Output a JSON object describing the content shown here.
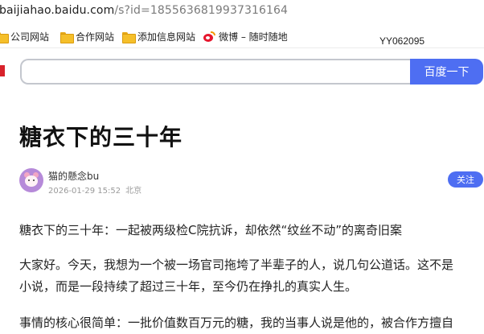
{
  "browser": {
    "url_host": "baijiahao.baidu.com",
    "url_rest": "/s?id=1855636819937316164"
  },
  "bookmarks": [
    {
      "label": "公司网站",
      "icon": "folder-icon"
    },
    {
      "label": "合作网站",
      "icon": "folder-icon"
    },
    {
      "label": "添加信息网站",
      "icon": "folder-icon"
    },
    {
      "label": "微博 – 随时随地",
      "icon": "weibo-icon"
    }
  ],
  "tagline": "YY062095",
  "search": {
    "value": "",
    "placeholder": "",
    "button_label": "百度一下"
  },
  "article": {
    "title": "糖衣下的三十年",
    "author": {
      "name": "猫的懸念bu",
      "date": "2026-01-29 15:52",
      "location": "北京",
      "follow_label": "关注"
    },
    "paragraphs": {
      "p1": "糖衣下的三十年：一起被两级检C院抗诉，却依然“纹丝不动”的离奇旧案",
      "p2_line1": "大家好。今天，我想为一个被一场官司拖垮了半辈子的人，说几句公道话。这不是",
      "p2_line2": "小说，而是一段持续了超过三十年，至今仍在挣扎的真实人生。",
      "p3": "事情的核心很简单：一批价值数百万元的糖，我的当事人说是他的，被合作方擅自"
    }
  },
  "colors": {
    "accent": "#4e6ef2",
    "folder": "#f5bf2a",
    "weibo": "#e6162d"
  }
}
